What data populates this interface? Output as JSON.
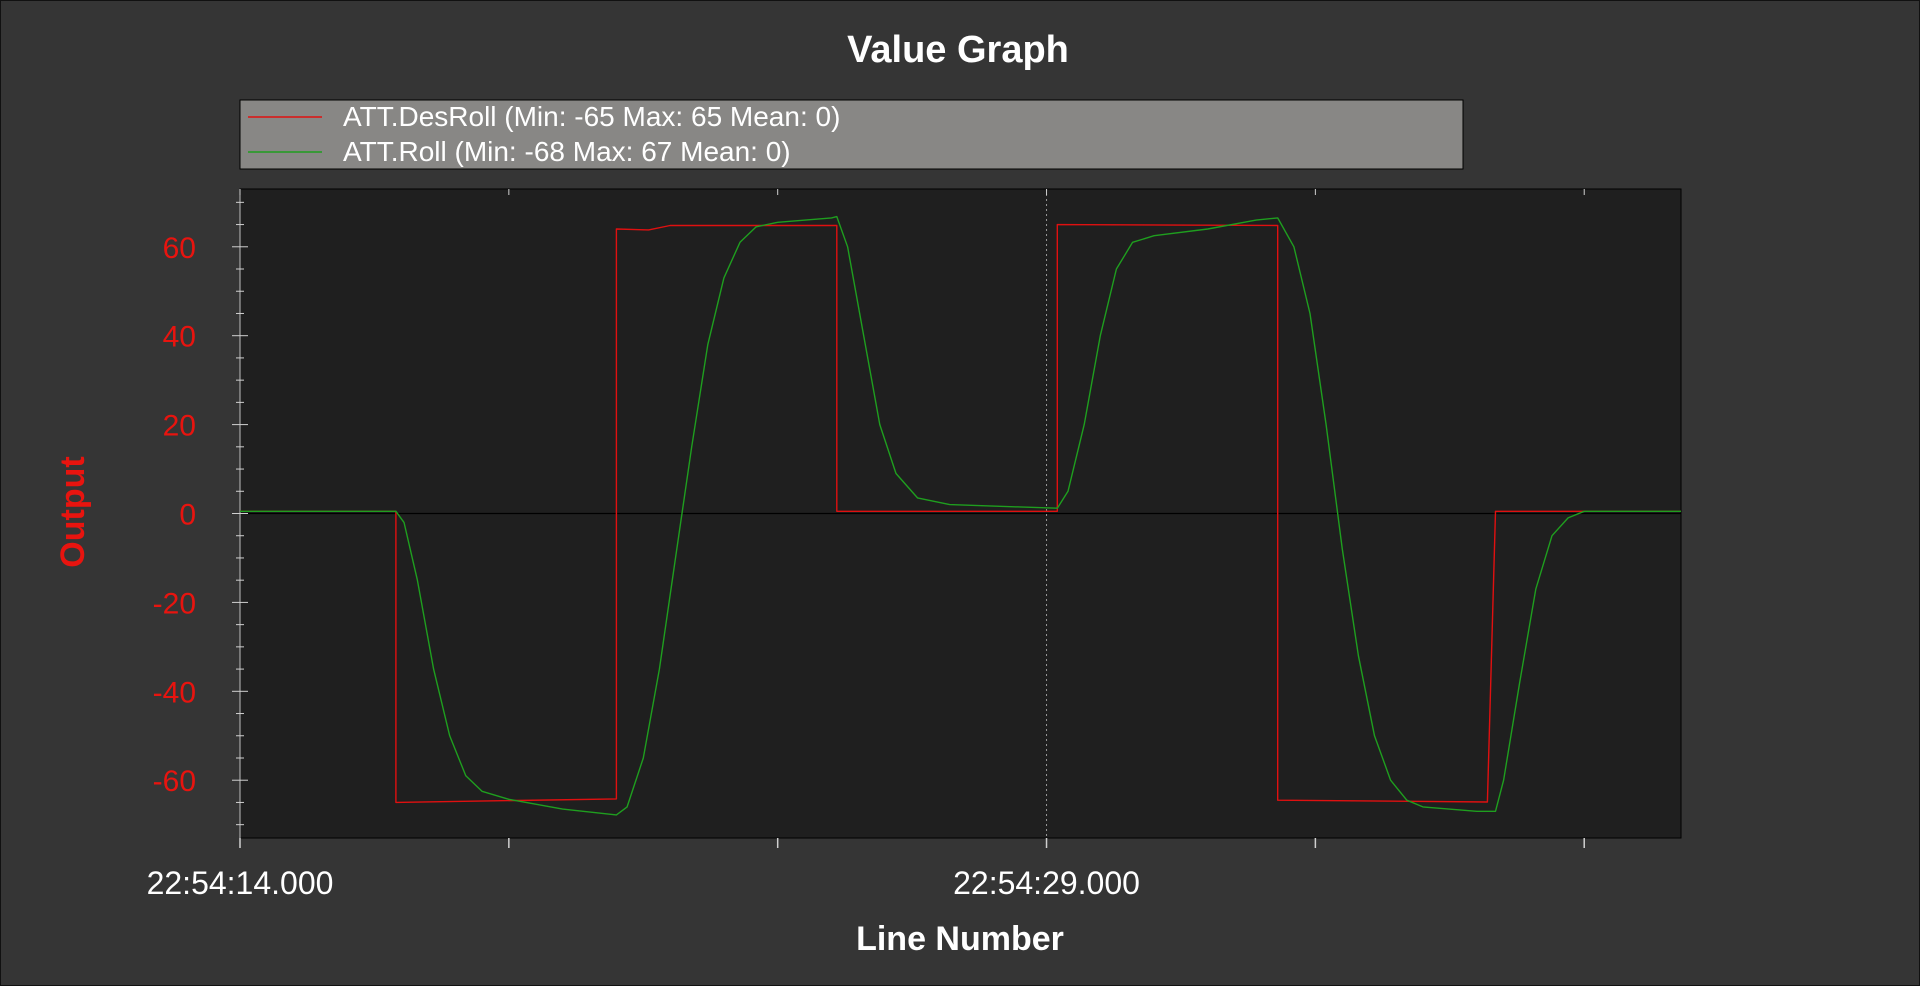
{
  "chart_data": {
    "type": "line",
    "title": "Value Graph",
    "xlabel": "Line Number",
    "ylabel": "Output",
    "x_unit": "seconds",
    "xlim": [
      0,
      26.8
    ],
    "ylim": [
      -73,
      73
    ],
    "yticks": [
      -60,
      -40,
      -20,
      0,
      20,
      40,
      60
    ],
    "xticks": [
      0,
      5,
      10,
      15,
      20,
      25
    ],
    "xtick_labels": [
      {
        "x": 0,
        "label": "22:54:14.000"
      },
      {
        "x": 15,
        "label": "22:54:29.000"
      }
    ],
    "legend_position": "top",
    "colors": {
      "background": "#353535",
      "plot_background": "#1f1f1f",
      "legend_background": "#888785",
      "axis_text": "#ffffff",
      "y_axis_text": "#e8140f",
      "zero_line": "#000000"
    },
    "series": [
      {
        "name": "ATT.DesRoll (Min: -65 Max: 65 Mean: 0)",
        "color": "#e01010",
        "points": [
          [
            0,
            0.5
          ],
          [
            2.9,
            0.5
          ],
          [
            2.9,
            -65
          ],
          [
            7.0,
            -64.2
          ],
          [
            7.0,
            64
          ],
          [
            7.6,
            63.8
          ],
          [
            8.0,
            64.8
          ],
          [
            11.1,
            64.8
          ],
          [
            11.1,
            0.5
          ],
          [
            15.2,
            0.5
          ],
          [
            15.2,
            65
          ],
          [
            19.3,
            64.8
          ],
          [
            19.3,
            -64.5
          ],
          [
            23.2,
            -64.9
          ],
          [
            23.35,
            0.5
          ],
          [
            26.8,
            0.5
          ]
        ]
      },
      {
        "name": "ATT.Roll (Min: -68 Max: 67 Mean: 0)",
        "color": "#1f9e1f",
        "points": [
          [
            0,
            0.5
          ],
          [
            2.9,
            0.5
          ],
          [
            3.05,
            -2
          ],
          [
            3.3,
            -15
          ],
          [
            3.6,
            -35
          ],
          [
            3.9,
            -50
          ],
          [
            4.2,
            -59
          ],
          [
            4.5,
            -62.5
          ],
          [
            5.0,
            -64.3
          ],
          [
            6.0,
            -66.5
          ],
          [
            7.0,
            -67.8
          ],
          [
            7.2,
            -66
          ],
          [
            7.5,
            -55
          ],
          [
            7.8,
            -35
          ],
          [
            8.1,
            -10
          ],
          [
            8.4,
            15
          ],
          [
            8.7,
            38
          ],
          [
            9.0,
            53
          ],
          [
            9.3,
            61
          ],
          [
            9.6,
            64.5
          ],
          [
            10.0,
            65.5
          ],
          [
            11.0,
            66.5
          ],
          [
            11.1,
            66.8
          ],
          [
            11.3,
            60
          ],
          [
            11.6,
            40
          ],
          [
            11.9,
            20
          ],
          [
            12.2,
            9
          ],
          [
            12.6,
            3.5
          ],
          [
            13.2,
            2
          ],
          [
            14.4,
            1.5
          ],
          [
            15.2,
            1.2
          ],
          [
            15.4,
            5
          ],
          [
            15.7,
            20
          ],
          [
            16.0,
            40
          ],
          [
            16.3,
            55
          ],
          [
            16.6,
            61
          ],
          [
            17.0,
            62.5
          ],
          [
            18.0,
            64
          ],
          [
            18.9,
            66
          ],
          [
            19.3,
            66.5
          ],
          [
            19.6,
            60
          ],
          [
            19.9,
            45
          ],
          [
            20.2,
            20
          ],
          [
            20.5,
            -8
          ],
          [
            20.8,
            -32
          ],
          [
            21.1,
            -50
          ],
          [
            21.4,
            -60
          ],
          [
            21.7,
            -64.5
          ],
          [
            22.0,
            -66
          ],
          [
            23.0,
            -67
          ],
          [
            23.35,
            -67
          ],
          [
            23.5,
            -60
          ],
          [
            23.8,
            -38
          ],
          [
            24.1,
            -17
          ],
          [
            24.4,
            -5
          ],
          [
            24.7,
            -1
          ],
          [
            25.0,
            0.5
          ],
          [
            26.8,
            0.5
          ]
        ]
      }
    ]
  }
}
